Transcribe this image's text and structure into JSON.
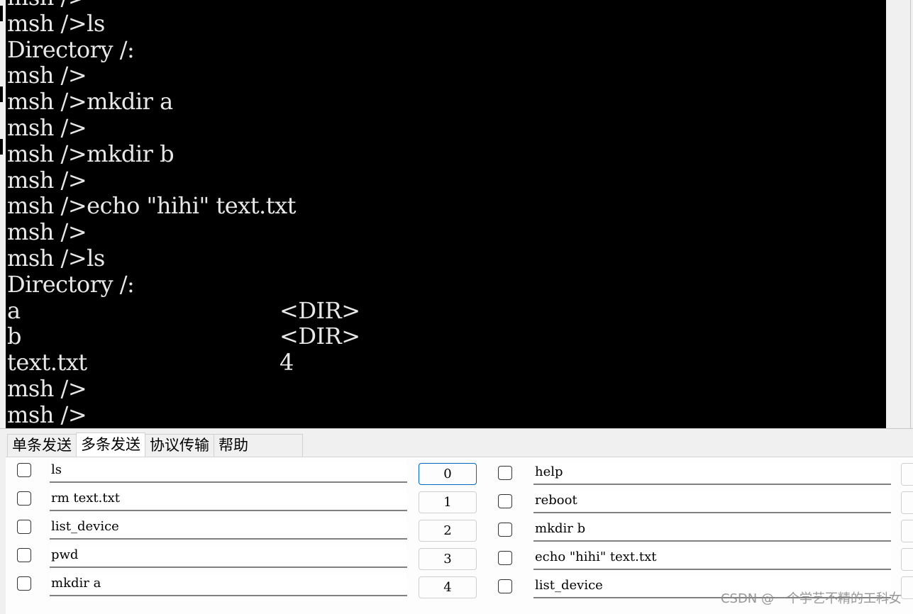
{
  "terminal": {
    "lines": [
      {
        "text": "msh />"
      },
      {
        "text": "msh />ls"
      },
      {
        "text": "Directory /:"
      },
      {
        "text": "msh />"
      },
      {
        "text": "msh />mkdir a"
      },
      {
        "text": "msh />"
      },
      {
        "text": "msh />mkdir b"
      },
      {
        "text": "msh />"
      },
      {
        "text": "msh />echo \"hihi\" text.txt"
      },
      {
        "text": "msh />"
      },
      {
        "text": "msh />ls"
      },
      {
        "text": "Directory /:"
      },
      {
        "name": "a",
        "info": "<DIR>"
      },
      {
        "name": "b",
        "info": "<DIR>"
      },
      {
        "name": "text.txt",
        "info": "4"
      },
      {
        "text": "msh />"
      },
      {
        "text": "msh />"
      }
    ]
  },
  "tabs": [
    {
      "label": "单条发送",
      "active": false
    },
    {
      "label": "多条发送",
      "active": true
    },
    {
      "label": "协议传输",
      "active": false
    },
    {
      "label": "帮助",
      "active": false
    }
  ],
  "multi_send": {
    "rows": [
      {
        "left_cmd": "ls",
        "button": "0",
        "right_cmd": "help",
        "focused": true
      },
      {
        "left_cmd": "rm text.txt",
        "button": "1",
        "right_cmd": "reboot",
        "focused": false
      },
      {
        "left_cmd": "list_device",
        "button": "2",
        "right_cmd": "mkdir b",
        "focused": false
      },
      {
        "left_cmd": "pwd",
        "button": "3",
        "right_cmd": "echo \"hihi\" text.txt",
        "focused": false
      },
      {
        "left_cmd": "mkdir a",
        "button": "4",
        "right_cmd": "list_device",
        "focused": false
      }
    ]
  },
  "watermark": "CSDN @一个学艺不精的工科女"
}
